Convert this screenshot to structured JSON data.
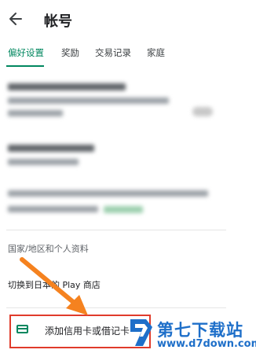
{
  "header": {
    "title": "帐号",
    "back_icon": "arrow-left-icon"
  },
  "tabs": [
    {
      "label": "偏好设置",
      "active": true
    },
    {
      "label": "奖励",
      "active": false
    },
    {
      "label": "交易记录",
      "active": false
    },
    {
      "label": "家庭",
      "active": false
    }
  ],
  "section": {
    "label": "国家/地区和个人资料"
  },
  "switch_store": {
    "label": "切换到日本的 Play 商店"
  },
  "payment": {
    "label": "添加信用卡或借记卡",
    "icon": "credit-card-icon"
  },
  "watermark": {
    "text": "第七下载站",
    "url": "www.d7down.com"
  },
  "colors": {
    "accent": "#01875f",
    "highlight": "#e03b2b",
    "arrow": "#f5821f",
    "watermark": "#1e6fc9"
  }
}
